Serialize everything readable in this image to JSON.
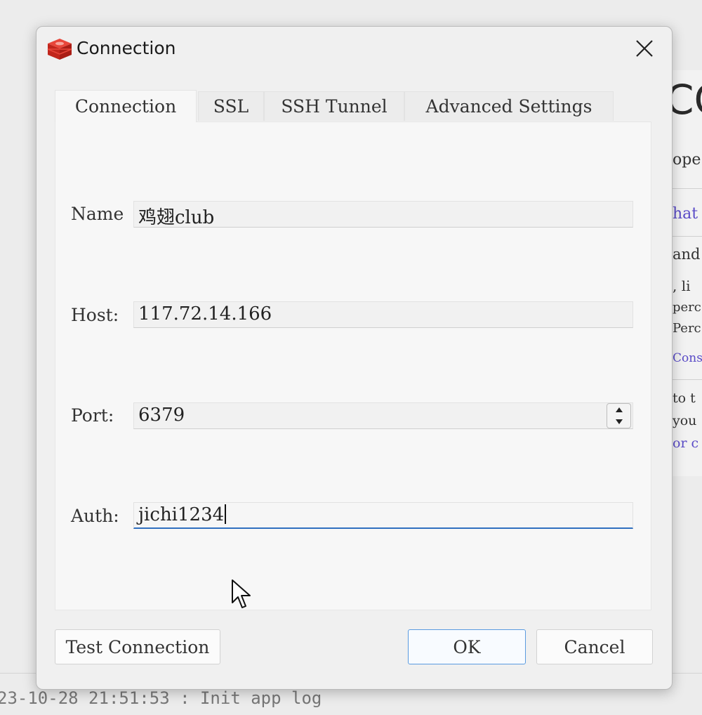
{
  "background": {
    "big_text": "CC",
    "lines": [
      "ope",
      "hat",
      "and",
      ", li",
      "perc",
      "Perc",
      "Conso",
      "to t",
      " you",
      "or c"
    ],
    "log_text": "23-10-28 21:51:53 : Init app log"
  },
  "dialog": {
    "title": "Connection",
    "tabs": [
      {
        "label": "Connection",
        "active": true
      },
      {
        "label": "SSL",
        "active": false
      },
      {
        "label": "SSH Tunnel",
        "active": false
      },
      {
        "label": "Advanced Settings",
        "active": false
      }
    ],
    "fields": {
      "name": {
        "label": "Name",
        "value": "鸡翅club"
      },
      "host": {
        "label": "Host:",
        "value": "117.72.14.166"
      },
      "port": {
        "label": "Port:",
        "value": "6379"
      },
      "auth": {
        "label": "Auth:",
        "value": "jichi1234"
      }
    },
    "buttons": {
      "test": "Test Connection",
      "ok": "OK",
      "cancel": "Cancel"
    }
  },
  "colors": {
    "accent": "#2f6fc0",
    "redis_red": "#d82c20",
    "link_purple": "#5a4bc7"
  },
  "icons": {
    "app": "redis-cube-icon",
    "close": "close-icon",
    "spinner_up": "spin-up-icon",
    "spinner_down": "spin-down-icon",
    "cursor": "mouse-pointer-icon"
  }
}
